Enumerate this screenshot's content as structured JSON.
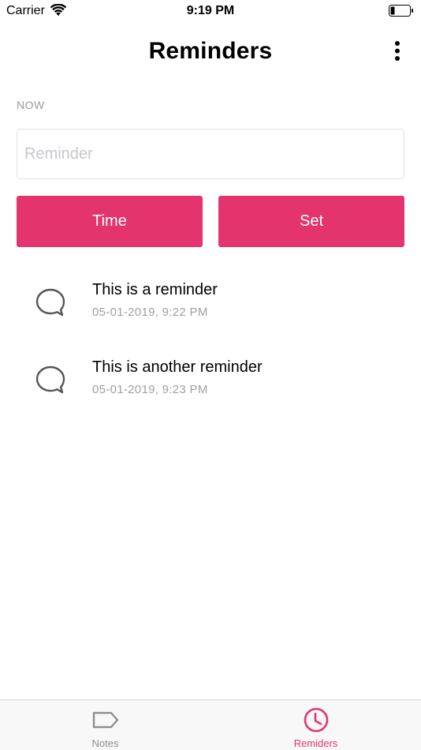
{
  "status_bar": {
    "carrier": "Carrier",
    "time": "9:19 PM"
  },
  "nav": {
    "title": "Reminders"
  },
  "form": {
    "section_label": "NOW",
    "reminder_placeholder": "Reminder",
    "reminder_value": "",
    "time_button_label": "Time",
    "set_button_label": "Set"
  },
  "reminders": [
    {
      "text": "This is a reminder",
      "datetime": "05-01-2019, 9:22 PM"
    },
    {
      "text": "This is another reminder",
      "datetime": "05-01-2019, 9:23 PM"
    }
  ],
  "tabs": [
    {
      "label": "Notes",
      "icon": "tag-icon",
      "active": false
    },
    {
      "label": "Remiders",
      "icon": "clock-icon",
      "active": true
    }
  ],
  "colors": {
    "accent": "#e3346e",
    "tab_inactive": "#8e8e93",
    "secondary_text": "#a0a0a0"
  }
}
